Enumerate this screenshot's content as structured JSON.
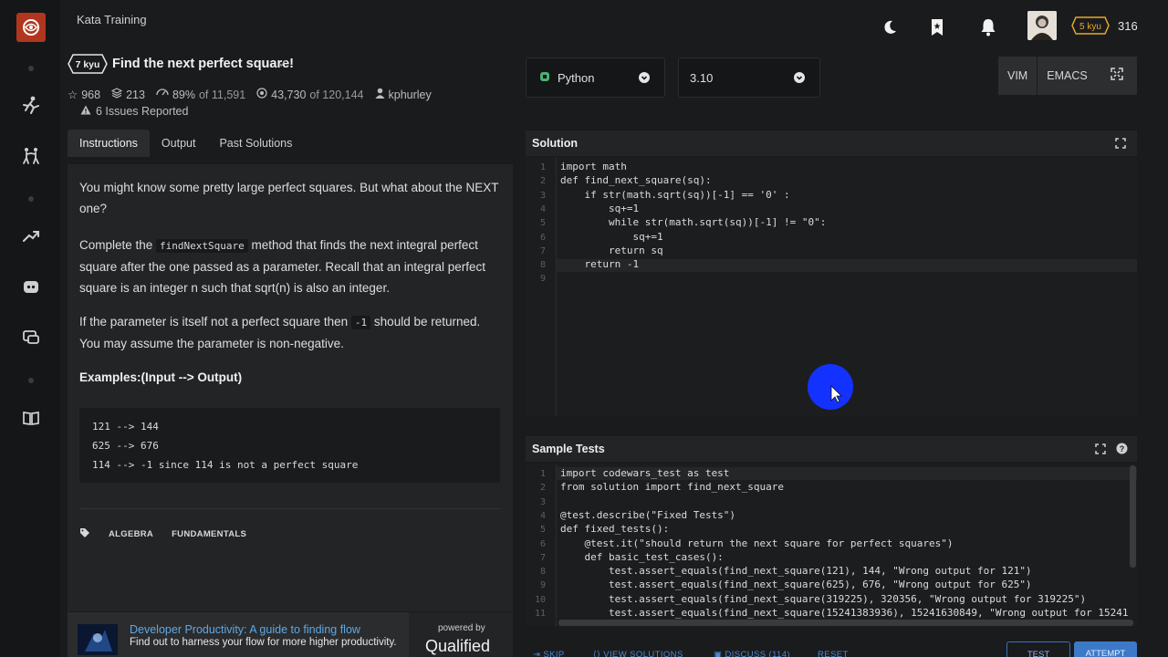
{
  "header": {
    "breadcrumb": "Kata Training",
    "rank": "5 kyu",
    "honor": "316"
  },
  "kata": {
    "kyu": "7 kyu",
    "title": "Find the next perfect square!",
    "stars": "968",
    "collections": "213",
    "satisfaction": "89%",
    "satisfaction_of": "of 11,591",
    "completed": "43,730",
    "completed_of": "of 120,144",
    "author": "kphurley",
    "issues": "6 Issues Reported"
  },
  "tabs": [
    "Instructions",
    "Output",
    "Past Solutions"
  ],
  "instructions": {
    "p1": "You might know some pretty large perfect squares. But what about the NEXT one?",
    "p2_a": "Complete the ",
    "p2_code": "findNextSquare",
    "p2_b": " method that finds the next integral perfect square after the one passed as a parameter. Recall that an integral perfect square is an integer n such that sqrt(n) is also an integer.",
    "p3_a": "If the parameter is itself not a perfect square then ",
    "p3_code": "-1",
    "p3_b": " should be returned. You may assume the parameter is non-negative.",
    "examples_title": "Examples:(Input --> Output)",
    "examples": [
      "121 --> 144",
      "625 --> 676",
      "114 --> -1 since 114 is not a perfect square"
    ],
    "tags": [
      "ALGEBRA",
      "FUNDAMENTALS"
    ]
  },
  "promo": {
    "title": "Developer Productivity: A guide to finding flow",
    "subtitle": "Find out to harness your flow for more higher productivity.",
    "powered_by": "powered by",
    "brand": "Qualified"
  },
  "editor_settings": {
    "language": "Python",
    "version": "3.10",
    "modes": [
      "VIM",
      "EMACS"
    ]
  },
  "solution": {
    "title": "Solution",
    "lines": [
      "import math",
      "def find_next_square(sq):",
      "    if str(math.sqrt(sq))[-1] == '0' :",
      "        sq+=1",
      "        while str(math.sqrt(sq))[-1] != \"0\":",
      "            sq+=1",
      "        return sq",
      "    return -1",
      ""
    ]
  },
  "sample_tests": {
    "title": "Sample Tests",
    "lines": [
      "import codewars_test as test",
      "from solution import find_next_square",
      "",
      "@test.describe(\"Fixed Tests\")",
      "def fixed_tests():",
      "    @test.it(\"should return the next square for perfect squares\")",
      "    def basic_test_cases():",
      "        test.assert_equals(find_next_square(121), 144, \"Wrong output for 121\")",
      "        test.assert_equals(find_next_square(625), 676, \"Wrong output for 625\")",
      "        test.assert_equals(find_next_square(319225), 320356, \"Wrong output for 319225\")",
      "        test.assert_equals(find_next_square(15241383936), 15241630849, \"Wrong output for 15241"
    ]
  },
  "bottom": {
    "skip": "SKIP",
    "view_solutions": "VIEW SOLUTIONS",
    "discuss": "DISCUSS (114)",
    "reset": "RESET",
    "test": "TEST",
    "attempt": "ATTEMPT"
  },
  "colors": {
    "accent": "#3c79c9",
    "brand": "#b1361e",
    "cursor": "#1432ff",
    "rank_badge": "#e5a72b"
  },
  "icons": [
    "codewars-logo-icon",
    "kata-icon",
    "dojo-icon",
    "leaderboard-icon",
    "discord-icon",
    "chat-icon",
    "docs-icon",
    "moon-icon",
    "bookmark-icon",
    "bell-icon",
    "star-icon",
    "collection-icon",
    "satisfaction-icon",
    "completed-icon",
    "user-icon",
    "warning-icon",
    "tag-icon",
    "python-icon",
    "chevron-down-icon",
    "fullscreen-icon",
    "help-icon",
    "skip-icon",
    "view-solutions-icon",
    "discuss-icon"
  ]
}
